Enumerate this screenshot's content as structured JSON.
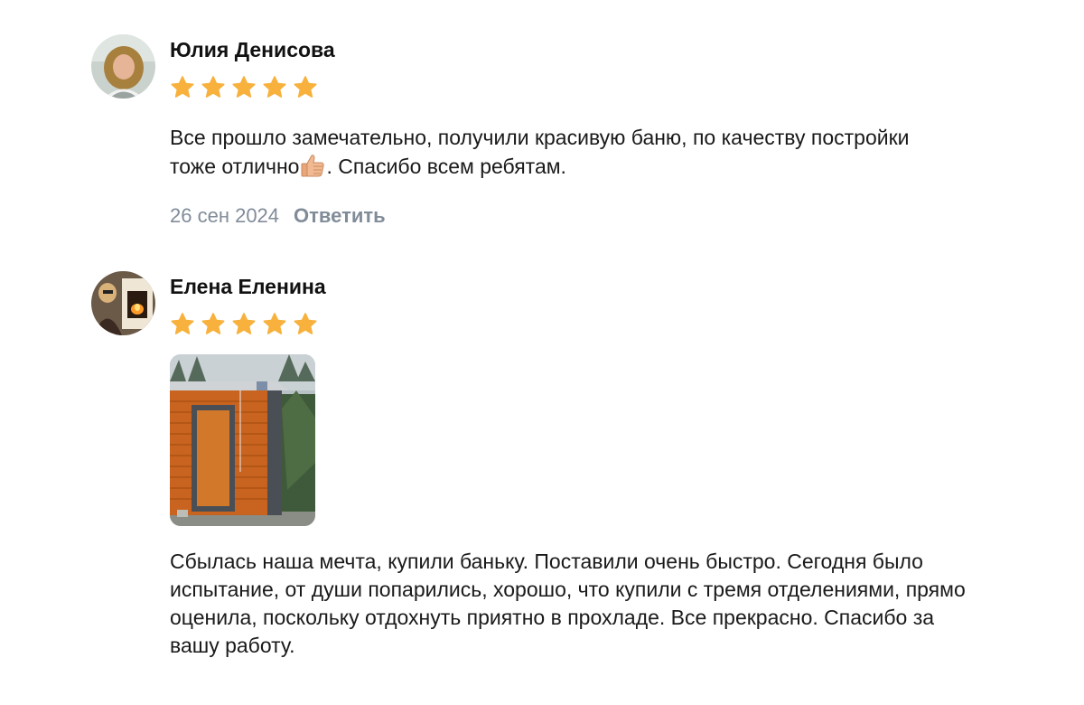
{
  "reviews": [
    {
      "author": "Юлия Денисова",
      "rating": 5,
      "text_before_emoji": "Все прошло замечательно, получили красивую баню, по качеству постройки тоже отлично",
      "emoji": "thumbs-up",
      "text_after_emoji": ". Спасибо всем ребятам.",
      "date": "26 сен 2024",
      "reply_label": "Ответить"
    },
    {
      "author": "Елена Еленина",
      "rating": 5,
      "text": "Сбылась наша мечта, купили баньку. Поставили очень быстро. Сегодня было испытание, от души попарились, хорошо, что купили с тремя отделениями, прямо оценила, поскольку отдохнуть приятно в прохладе. Все прекрасно. Спасибо за вашу работу."
    }
  ],
  "colors": {
    "star": "#f7b13c",
    "meta": "#818c99",
    "text": "#111111"
  }
}
